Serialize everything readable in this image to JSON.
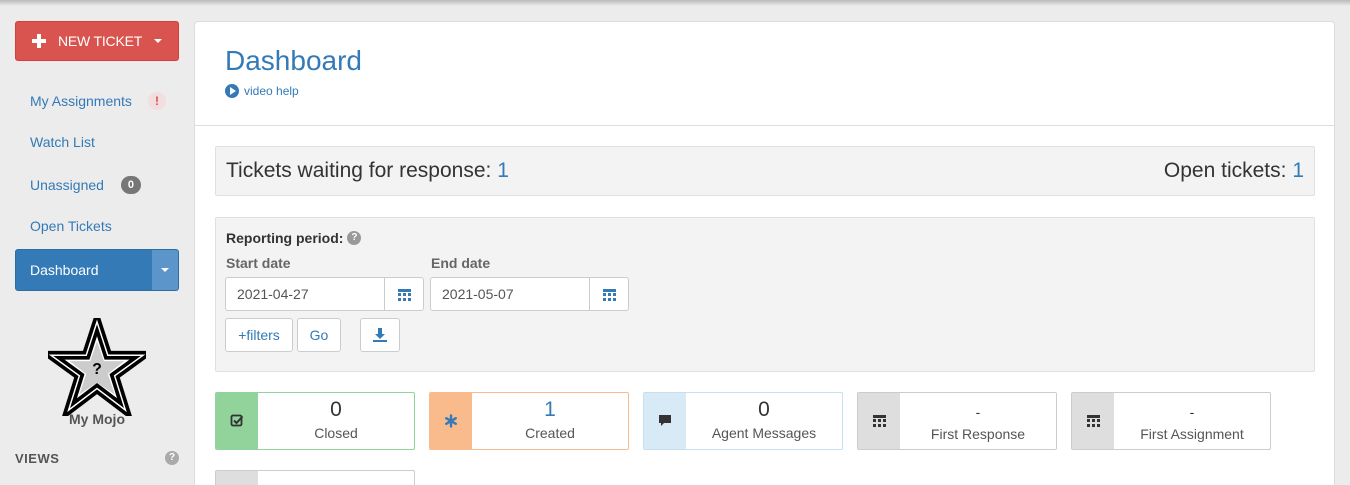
{
  "sidebar": {
    "new_ticket_label": "NEW TICKET",
    "items": [
      {
        "label": "My Assignments",
        "badge": "!"
      },
      {
        "label": "Watch List"
      },
      {
        "label": "Unassigned",
        "badge": "0"
      },
      {
        "label": "Open Tickets"
      },
      {
        "label": "Dashboard"
      }
    ],
    "mojo_icon_text": "?",
    "mojo_label": "My Mojo",
    "views_label": "VIEWS",
    "views_help": "?"
  },
  "header": {
    "title": "Dashboard",
    "video_help": "video help"
  },
  "summary": {
    "waiting_label": "Tickets waiting for response:",
    "waiting_value": "1",
    "open_label": "Open tickets:",
    "open_value": "1"
  },
  "report": {
    "period_label": "Reporting period:",
    "help": "?",
    "start_label": "Start date",
    "start_value": "2021-04-27",
    "end_label": "End date",
    "end_value": "2021-05-07",
    "filters_label": "+filters",
    "go_label": "Go"
  },
  "cards": [
    {
      "icon": "check-square-icon",
      "value": "0",
      "label": "Closed",
      "color": "#92d39c",
      "border": "#92d39c"
    },
    {
      "icon": "asterisk-icon",
      "value": "1",
      "label": "Created",
      "color": "#f9bb8c",
      "border": "#f9bb8c"
    },
    {
      "icon": "comment-icon",
      "value": "0",
      "label": "Agent Messages",
      "color": "#d7eaf6",
      "border": "#c6e0f0"
    },
    {
      "icon": "calendar-icon",
      "value": "-",
      "label": "First Response",
      "color": "#dedede",
      "border": "#cccccc"
    },
    {
      "icon": "calendar-icon",
      "value": "-",
      "label": "First Assignment",
      "color": "#dedede",
      "border": "#cccccc"
    }
  ],
  "colors": {
    "accent": "#337ab7",
    "danger": "#d9534f",
    "background": "#ececec"
  }
}
